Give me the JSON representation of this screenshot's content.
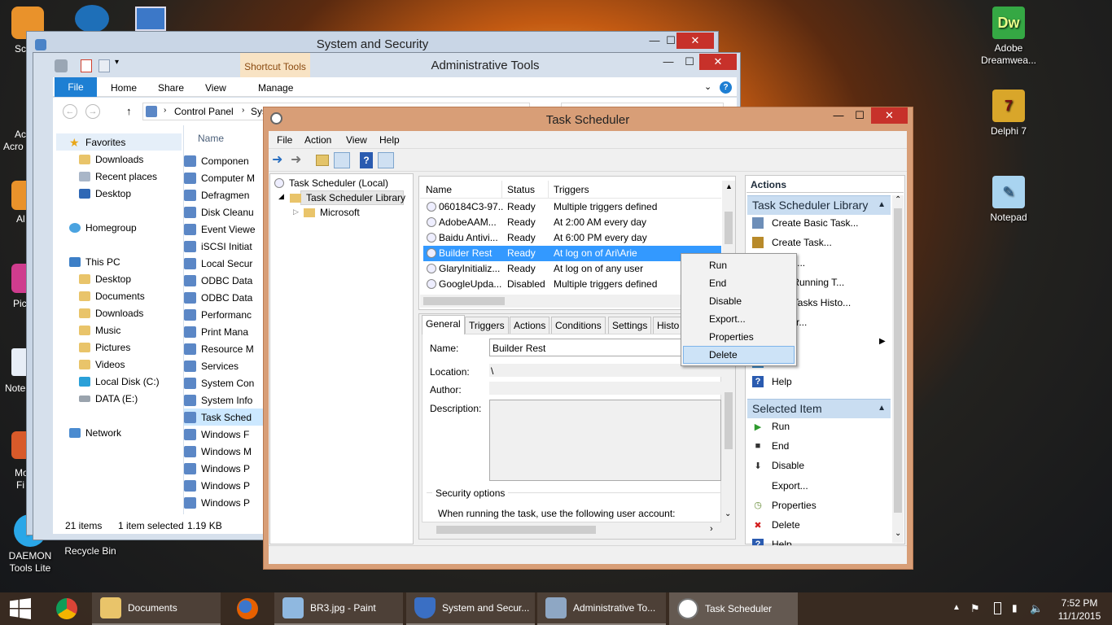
{
  "desktop": {
    "icons": [
      {
        "label": "Adobe Dreamwea...",
        "glyph": "Dw"
      },
      {
        "label": "Delphi 7",
        "glyph": "7"
      },
      {
        "label": "Notepad",
        "glyph": "✎"
      },
      {
        "label": "DAEMON Tools Lite",
        "glyph": "⚡"
      },
      {
        "label": "Recycle Bin",
        "glyph": "🗑"
      }
    ],
    "left_partial": [
      "Sc",
      "Ac",
      "Acro",
      "Al",
      "Pic",
      "Note",
      "Mo",
      "Fi"
    ]
  },
  "sys_window": {
    "title": "System and Security",
    "buttons": {
      "minimize": "—",
      "maximize": "☐",
      "close": "✕"
    }
  },
  "admin_window": {
    "title": "Administrative Tools",
    "contextual_tab": "Shortcut Tools",
    "ribbon_tabs": [
      "File",
      "Home",
      "Share",
      "View",
      "Manage"
    ],
    "address": [
      "Control Panel",
      "Sys"
    ],
    "nav": {
      "favorites": "Favorites",
      "favorites_items": [
        "Downloads",
        "Recent places",
        "Desktop"
      ],
      "homegroup": "Homegroup",
      "this_pc": "This PC",
      "pc_items": [
        "Desktop",
        "Documents",
        "Downloads",
        "Music",
        "Pictures",
        "Videos",
        "Local Disk (C:)",
        "DATA (E:)"
      ],
      "network": "Network"
    },
    "column_name": "Name",
    "files": [
      "Componen",
      "Computer M",
      "Defragmen",
      "Disk Cleanu",
      "Event Viewe",
      "iSCSI Initiat",
      "Local Secur",
      "ODBC Data",
      "ODBC Data",
      "Performanc",
      "Print Mana",
      "Resource M",
      "Services",
      "System Con",
      "System Info",
      "Task Sched",
      "Windows F",
      "Windows M",
      "Windows P",
      "Windows P",
      "Windows P"
    ],
    "selected_file_index": 15,
    "status": {
      "items": "21 items",
      "selected": "1 item selected",
      "size": "1.19 KB"
    }
  },
  "task_scheduler": {
    "title": "Task Scheduler",
    "menu": [
      "File",
      "Action",
      "View",
      "Help"
    ],
    "tree": {
      "root": "Task Scheduler (Local)",
      "library": "Task Scheduler Library",
      "child": "Microsoft"
    },
    "columns": [
      "Name",
      "Status",
      "Triggers"
    ],
    "tasks": [
      {
        "name": "060184C3-97...",
        "status": "Ready",
        "trigger": "Multiple triggers defined"
      },
      {
        "name": "AdobeAAM...",
        "status": "Ready",
        "trigger": "At 2:00 AM every day"
      },
      {
        "name": "Baidu Antivi...",
        "status": "Ready",
        "trigger": "At 6:00 PM every day"
      },
      {
        "name": "Builder Rest",
        "status": "Ready",
        "trigger": "At log on of Ari\\Arie"
      },
      {
        "name": "GlaryInitializ...",
        "status": "Ready",
        "trigger": "At log on of any user"
      },
      {
        "name": "GoogleUpda...",
        "status": "Disabled",
        "trigger": "Multiple triggers defined"
      }
    ],
    "selected_task_index": 3,
    "detail_tabs": [
      "General",
      "Triggers",
      "Actions",
      "Conditions",
      "Settings",
      "Histo"
    ],
    "general": {
      "name_label": "Name:",
      "name_value": "Builder Rest",
      "location_label": "Location:",
      "location_value": "\\",
      "author_label": "Author:",
      "author_value": "",
      "description_label": "Description:",
      "security_label": "Security options",
      "security_text": "When running the task, use the following user account:"
    },
    "actions": {
      "header": "Actions",
      "library_section": "Task Scheduler Library",
      "library_items": [
        {
          "label": "Create Basic Task...",
          "icon": "clock-icon"
        },
        {
          "label": "Create Task...",
          "icon": "clock-icon"
        },
        {
          "label": "t Task...",
          "icon": "import-icon"
        },
        {
          "label": "y All Running T...",
          "icon": "list-icon"
        },
        {
          "label": "e All Tasks Histo...",
          "icon": "history-icon"
        },
        {
          "label": "Folder...",
          "icon": "folder-icon"
        },
        {
          "label": "",
          "icon": "view-icon"
        },
        {
          "label": "h",
          "icon": "refresh-icon"
        },
        {
          "label": "Help",
          "icon": "help-icon"
        }
      ],
      "selected_section": "Selected Item",
      "selected_items": [
        {
          "label": "Run",
          "icon": "run-icon",
          "glyph": "▶",
          "color": "#2e9a2e"
        },
        {
          "label": "End",
          "icon": "stop-icon",
          "glyph": "■",
          "color": "#333333"
        },
        {
          "label": "Disable",
          "icon": "disable-icon",
          "glyph": "⬇",
          "color": "#333333"
        },
        {
          "label": "Export...",
          "icon": "export-icon",
          "glyph": "",
          "color": "#333333"
        },
        {
          "label": "Properties",
          "icon": "properties-icon",
          "glyph": "◷",
          "color": "#6a8e3a"
        },
        {
          "label": "Delete",
          "icon": "delete-icon",
          "glyph": "✖",
          "color": "#d32020"
        },
        {
          "label": "Help",
          "icon": "help-icon",
          "glyph": "?",
          "color": "#2a5bb0"
        }
      ]
    },
    "context_menu": [
      "Run",
      "End",
      "Disable",
      "Export...",
      "Properties",
      "Delete"
    ],
    "context_selected_index": 5
  },
  "taskbar": {
    "buttons": [
      {
        "label": "",
        "icon": "chrome-icon"
      },
      {
        "label": "Documents",
        "icon": "folder-icon"
      },
      {
        "label": "",
        "icon": "firefox-icon"
      },
      {
        "label": "BR3.jpg - Paint",
        "icon": "paint-icon"
      },
      {
        "label": "System and Secur...",
        "icon": "shield-icon"
      },
      {
        "label": "Administrative To...",
        "icon": "admin-tools-icon"
      },
      {
        "label": "Task Scheduler",
        "icon": "clock-icon"
      }
    ],
    "time": "7:52 PM",
    "date": "11/1/2015"
  },
  "colors": {
    "accent": "#1e7fd3",
    "selection": "#3399ff",
    "ts_frame": "#d89e77",
    "explorer_frame": "#c9d6e6",
    "shortcut_tools": "#f8e3c4",
    "actions_header": "#c9ddf1",
    "delete_red": "#d32020"
  }
}
